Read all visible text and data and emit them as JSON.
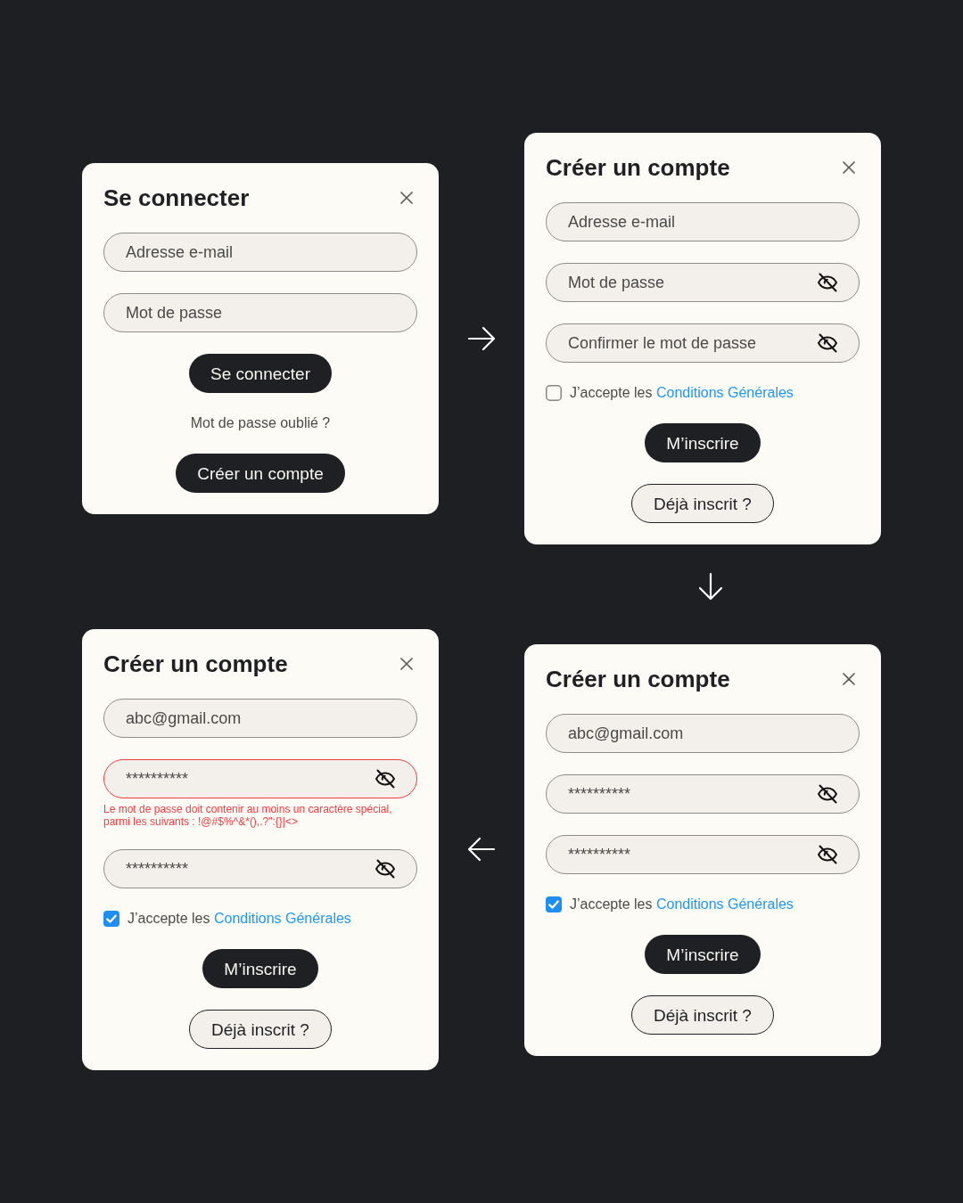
{
  "screens": [
    {
      "title": "Se connecter",
      "items": [
        {
          "kind": "field",
          "placeholder": "Adresse e-mail",
          "visibility_toggle": false
        },
        {
          "kind": "field",
          "placeholder": "Mot de passe",
          "visibility_toggle": false
        },
        {
          "kind": "button",
          "label": "Se connecter"
        },
        {
          "kind": "link",
          "label": "Mot de passe oublié ?"
        },
        {
          "kind": "button",
          "label": "Créer un compte"
        }
      ]
    },
    {
      "title": "Créer un compte",
      "items": [
        {
          "kind": "field",
          "placeholder": "Adresse e-mail",
          "visibility_toggle": false
        },
        {
          "kind": "field",
          "placeholder": "Mot de passe",
          "visibility_toggle": true
        },
        {
          "kind": "field",
          "placeholder": "Confirmer le mot de passe",
          "visibility_toggle": true
        },
        {
          "kind": "checkbox",
          "checked": false,
          "text": "J’accepte les",
          "link_label": "Conditions Générales"
        },
        {
          "kind": "button",
          "label": "M’inscrire"
        },
        {
          "kind": "outline",
          "label": "Déjà inscrit ?"
        }
      ]
    },
    {
      "title": "Créer un compte",
      "items": [
        {
          "kind": "field",
          "value": "abc@gmail.com",
          "visibility_toggle": false
        },
        {
          "kind": "field",
          "value": "**********",
          "visibility_toggle": true,
          "error": "Le mot de passe doit contenir au moins un caractère spécial, parmi les suivants : !@#$%^&*(),.?\":{}|<>"
        },
        {
          "kind": "field",
          "value": "**********",
          "visibility_toggle": true
        },
        {
          "kind": "checkbox",
          "checked": true,
          "text": "J’accepte les",
          "link_label": "Conditions Générales"
        },
        {
          "kind": "button",
          "label": "M’inscrire"
        },
        {
          "kind": "outline",
          "label": "Déjà inscrit ?"
        }
      ]
    },
    {
      "title": "Créer un compte",
      "items": [
        {
          "kind": "field",
          "value": "abc@gmail.com",
          "visibility_toggle": false
        },
        {
          "kind": "field",
          "value": "**********",
          "visibility_toggle": true
        },
        {
          "kind": "field",
          "value": "**********",
          "visibility_toggle": true
        },
        {
          "kind": "checkbox",
          "checked": true,
          "text": "J’accepte les",
          "link_label": "Conditions Générales"
        },
        {
          "kind": "button",
          "label": "M’inscrire"
        },
        {
          "kind": "outline",
          "label": "Déjà inscrit ?"
        }
      ]
    }
  ]
}
